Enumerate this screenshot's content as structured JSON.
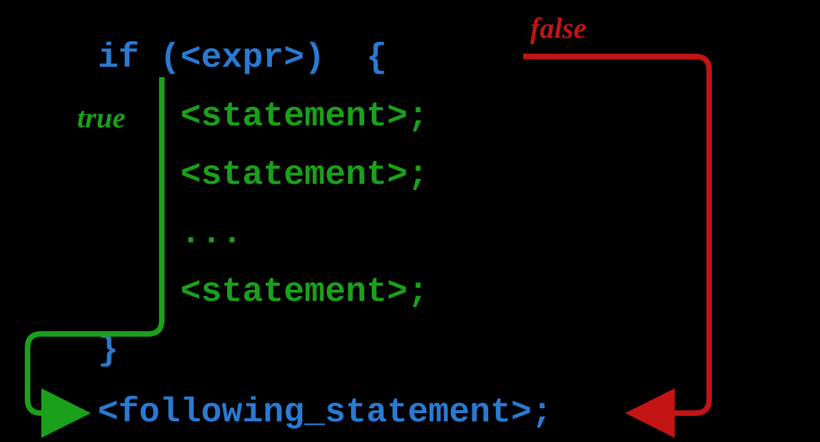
{
  "labels": {
    "false": "false",
    "true": "true"
  },
  "code": {
    "if_line": "if (<expr>)  {",
    "stmt": "<statement>;",
    "ellipsis": "...",
    "close_brace": "}",
    "following": "<following_statement>;"
  },
  "colors": {
    "blue": "#2a7ad2",
    "green": "#1aa01a",
    "red": "#c21414"
  }
}
